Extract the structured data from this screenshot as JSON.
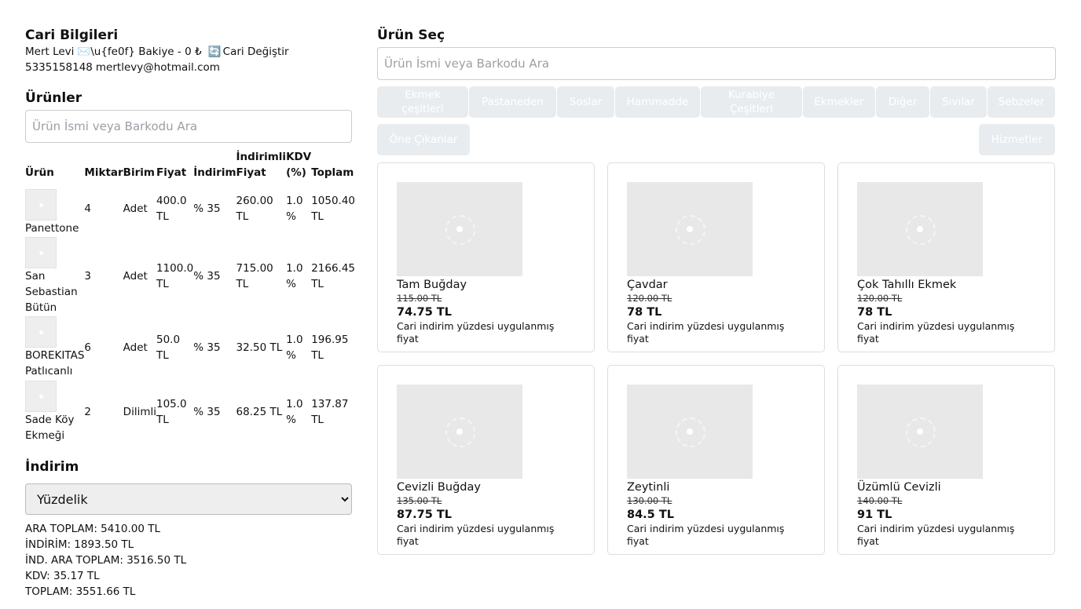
{
  "cari": {
    "title": "Cari Bilgileri",
    "name": "Mert Levi",
    "mail_icon": "✉️\\u{fe0f}",
    "balance": "Bakiye - 0 ₺",
    "change_icon": "🔄",
    "change_label": "Cari Değiştir",
    "phone": "5335158148",
    "email": "mertlevy@hotmail.com"
  },
  "products": {
    "title": "Ürünler",
    "search_placeholder": "Ürün İsmi veya Barkodu Ara",
    "columns": [
      "Ürün",
      "Miktar",
      "Birim",
      "Fiyat",
      "İndirim",
      "İndirimli Fiyat",
      "KDV (%)",
      "Toplam"
    ],
    "rows": [
      {
        "name": "Panettone",
        "qty": "4",
        "unit": "Adet",
        "price": "400.0 TL",
        "discount": "% 35",
        "discounted": "260.00 TL",
        "kdv": "1.0 %",
        "total": "1050.40 TL"
      },
      {
        "name": "San Sebastian Bütün",
        "qty": "3",
        "unit": "Adet",
        "price": "1100.0 TL",
        "discount": "% 35",
        "discounted": "715.00 TL",
        "kdv": "1.0 %",
        "total": "2166.45 TL"
      },
      {
        "name": "BOREKITAS Patlıcanlı",
        "qty": "6",
        "unit": "Adet",
        "price": "50.0 TL",
        "discount": "% 35",
        "discounted": "32.50 TL",
        "kdv": "1.0 %",
        "total": "196.95 TL"
      },
      {
        "name": "Sade Köy Ekmeği",
        "qty": "2",
        "unit": "Dilimli",
        "price": "105.0 TL",
        "discount": "% 35",
        "discounted": "68.25 TL",
        "kdv": "1.0 %",
        "total": "137.87 TL"
      }
    ]
  },
  "discount": {
    "title": "İndirim",
    "selected": "Yüzdelik"
  },
  "totals": {
    "ara_toplam": "ARA TOPLAM: 5410.00 TL",
    "indirim": "İNDİRİM: 1893.50 TL",
    "ind_ara_toplam": "İND. ARA TOPLAM: 3516.50 TL",
    "kdv": "KDV: 35.17 TL",
    "toplam": "TOPLAM: 3551.66 TL"
  },
  "select_product": {
    "title": "Ürün Seç",
    "search_placeholder": "Ürün İsmi veya Barkodu Ara",
    "categories": [
      "Ekmek çeşitleri",
      "Pastaneden",
      "Soslar",
      "Hammadde",
      "Kurabiye Çeşitleri",
      "Ekmekler",
      "Diğer",
      "Sıvılar",
      "Sebzeler"
    ],
    "featured_label": "Öne Çıkanlar",
    "services_label": "Hizmetler",
    "cards": [
      {
        "name": "Tam Buğday",
        "old_price": "115.00 TL",
        "new_price": "74.75 TL",
        "note": "Cari indirim yüzdesi uygulanmış fiyat"
      },
      {
        "name": "Çavdar",
        "old_price": "120.00 TL",
        "new_price": "78 TL",
        "note": "Cari indirim yüzdesi uygulanmış fiyat"
      },
      {
        "name": "Çok Tahıllı Ekmek",
        "old_price": "120.00 TL",
        "new_price": "78 TL",
        "note": "Cari indirim yüzdesi uygulanmış fiyat"
      },
      {
        "name": "Cevizli Buğday",
        "old_price": "135.00 TL",
        "new_price": "87.75 TL",
        "note": "Cari indirim yüzdesi uygulanmış fiyat"
      },
      {
        "name": "Zeytinli",
        "old_price": "130.00 TL",
        "new_price": "84.5 TL",
        "note": "Cari indirim yüzdesi uygulanmış fiyat"
      },
      {
        "name": "Üzümlü Cevizli",
        "old_price": "140.00 TL",
        "new_price": "91 TL",
        "note": "Cari indirim yüzdesi uygulanmış fiyat"
      }
    ]
  }
}
